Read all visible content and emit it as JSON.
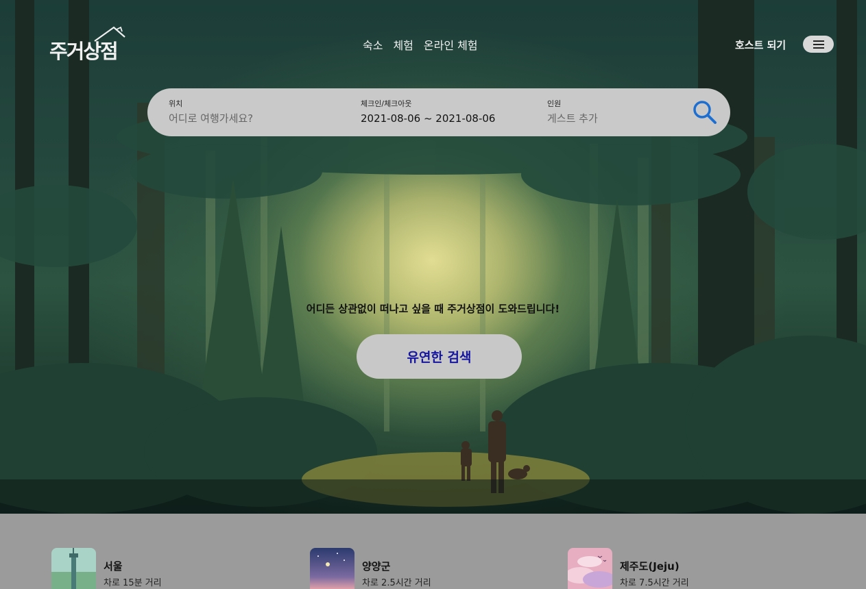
{
  "brand": {
    "logo_text": "주거상점"
  },
  "nav": {
    "items": [
      "숙소",
      "체험",
      "온라인 체험"
    ]
  },
  "header": {
    "host_label": "호스트 되기",
    "menu_icon": "hamburger-icon"
  },
  "search": {
    "location": {
      "label": "위치",
      "placeholder": "어디로 여행가세요?"
    },
    "dates": {
      "label": "체크인/체크아웃",
      "value": "2021-08-06 ~ 2021-08-06"
    },
    "guests": {
      "label": "인원",
      "placeholder": "게스트 추가"
    },
    "button_icon": "search-icon"
  },
  "hero": {
    "tagline": "어디든 상관없이 떠나고 싶을 때 주거상점이 도와드립니다!",
    "cta_label": "유연한 검색"
  },
  "nearby": [
    {
      "name": "서울",
      "distance": "차로 15분 거리"
    },
    {
      "name": "양양군",
      "distance": "차로 2.5시간 거리"
    },
    {
      "name": "제주도(Jeju)",
      "distance": "차로 7.5시간 거리"
    }
  ],
  "colors": {
    "accent_blue": "#1c6fd1",
    "cta_text": "#1515a0",
    "search_bar_bg": "#c9c9c9"
  }
}
